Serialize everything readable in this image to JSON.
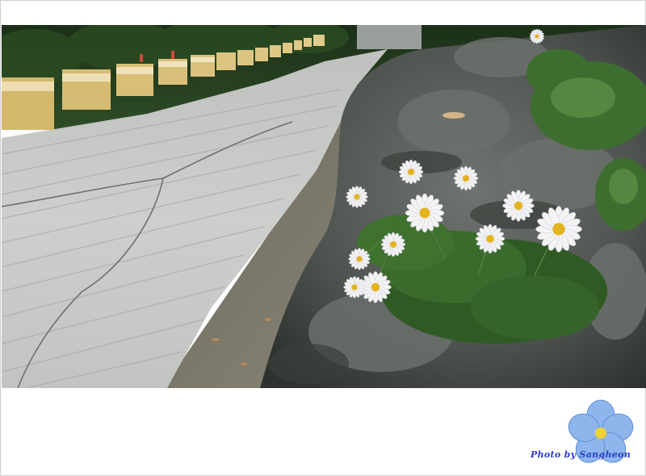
{
  "photo": {
    "subject": "daisies-on-rock-beside-road",
    "palette": {
      "foliage_dark": "#1f3a1c",
      "road": "#c9cbc9",
      "rail_yellow": "#d8c07a",
      "rock": "#5d625e",
      "petal": "#f4f4f6",
      "center": "#e3b31e"
    }
  },
  "credit": {
    "text": "Photo by Sangheon",
    "color": "#2a3cc8"
  },
  "logo": {
    "icon": "forget-me-not-flower-icon",
    "petal_color": "#8fb6ec",
    "center_color": "#f2d23a"
  }
}
